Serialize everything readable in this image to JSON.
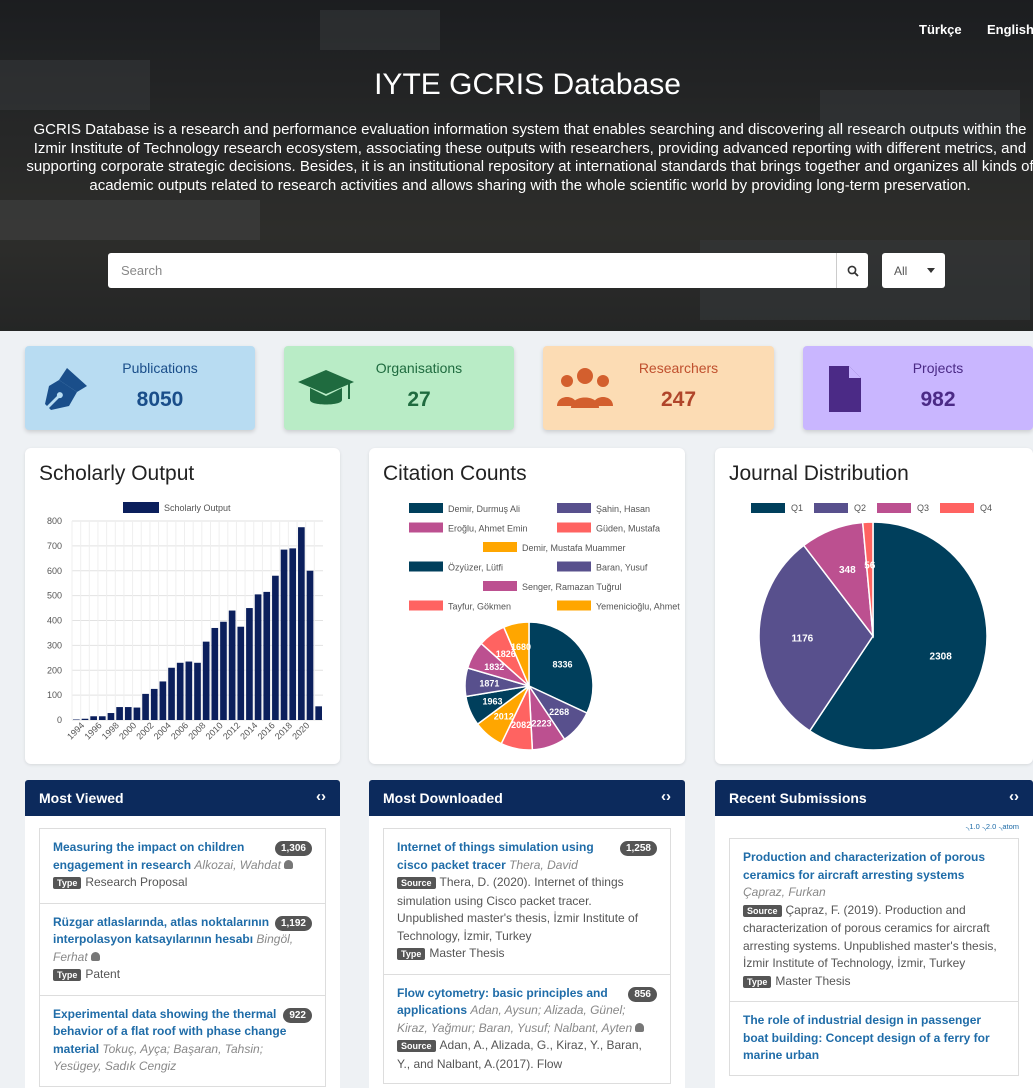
{
  "header": {
    "title": "IYTE GCRIS Database",
    "description": "GCRIS Database is a research and performance evaluation information system that enables searching and discovering all research outputs within the Izmir Institute of Technology research ecosystem, associating these outputs with researchers, providing advanced reporting with different metrics, and supporting corporate strategic decisions. Besides, it is an institutional repository at international standards that brings together and organizes all kinds of academic outputs related to research activities and allows sharing with the whole scientific world by providing long-term preservation.",
    "lang_tr": "Türkçe",
    "lang_en": "English"
  },
  "search": {
    "placeholder": "Search",
    "scope": "All"
  },
  "stats": [
    {
      "label": "Publications",
      "value": "8050",
      "icon": "pen-icon",
      "color": "#1a4e8a",
      "bg": "#b8dcf2"
    },
    {
      "label": "Organisations",
      "value": "27",
      "icon": "graduation-cap-icon",
      "color": "#1f6b3f",
      "bg": "#b9ecc6"
    },
    {
      "label": "Researchers",
      "value": "247",
      "icon": "users-icon",
      "color": "#b0452a",
      "bg": "#fcdcb4"
    },
    {
      "label": "Projects",
      "value": "982",
      "icon": "file-icon",
      "color": "#4b2a86",
      "bg": "#c9b6ff"
    }
  ],
  "charts": {
    "scholarly": "Scholarly Output",
    "citations": "Citation Counts",
    "journal": "Journal Distribution"
  },
  "chart_data": [
    {
      "type": "bar",
      "title": "Scholarly Output",
      "series": [
        {
          "name": "Scholarly Output"
        }
      ],
      "ylim": [
        0,
        800
      ],
      "yticks": [
        0,
        100,
        200,
        300,
        400,
        500,
        600,
        700,
        800
      ],
      "categories": [
        "1993",
        "1994",
        "1995",
        "1996",
        "1997",
        "1998",
        "1999",
        "2000",
        "2001",
        "2002",
        "2003",
        "2004",
        "2005",
        "2006",
        "2007",
        "2008",
        "2009",
        "2010",
        "2011",
        "2012",
        "2013",
        "2014",
        "2015",
        "2016",
        "2017",
        "2018",
        "2019",
        "2020",
        "2021"
      ],
      "xticklabels": [
        "1994",
        "1996",
        "1998",
        "2000",
        "2002",
        "2004",
        "2006",
        "2008",
        "2010",
        "2012",
        "2014",
        "2016",
        "2018",
        "2020"
      ],
      "values": [
        2,
        5,
        15,
        15,
        28,
        52,
        52,
        50,
        105,
        125,
        155,
        210,
        230,
        235,
        230,
        315,
        370,
        395,
        440,
        375,
        450,
        505,
        515,
        580,
        685,
        690,
        775,
        600,
        55
      ],
      "color": "#0b1f5c"
    },
    {
      "type": "pie",
      "title": "Citation Counts",
      "categories": [
        "Demir, Durmuş Ali",
        "Şahin, Hasan",
        "Eroğlu, Ahmet Emin",
        "Güden, Mustafa",
        "Demir, Mustafa Muammer",
        "Özyüzer, Lütfi",
        "Baran, Yusuf",
        "Senger, Ramazan Tuğrul",
        "Tayfur, Gökmen",
        "Yemenicioğlu, Ahmet"
      ],
      "values": [
        8336,
        2268,
        2223,
        2082,
        2012,
        1963,
        1871,
        1832,
        1826,
        1680
      ],
      "labels": [
        "8336",
        "2268",
        "2223",
        "2082",
        "2012",
        "1963",
        "1871",
        "1832",
        "1826",
        "1680"
      ],
      "colors": [
        "#003f5c",
        "#58508d",
        "#bc5090",
        "#ff6361",
        "#ffa600",
        "#003f5c",
        "#58508d",
        "#bc5090",
        "#ff6361",
        "#ffa600"
      ]
    },
    {
      "type": "pie",
      "title": "Journal Distribution",
      "categories": [
        "Q1",
        "Q2",
        "Q3",
        "Q4"
      ],
      "values": [
        2308,
        1176,
        348,
        56
      ],
      "labels": [
        "2308",
        "1176",
        "348",
        "56"
      ],
      "colors": [
        "#003f5c",
        "#58508d",
        "#bc5090",
        "#ff6361"
      ]
    }
  ],
  "panels": [
    {
      "title": "Most Viewed",
      "items": [
        {
          "title": "Measuring the impact on children engagement in research",
          "author": "Alkozai, Wahdat",
          "count": "1,306",
          "type": "Research Proposal"
        },
        {
          "title": "Rüzgar atlaslarında, atlas noktalarının interpolasyon katsayılarının hesabı",
          "author": "Bingöl, Ferhat",
          "count": "1,192",
          "type": "Patent"
        },
        {
          "title": "Experimental data showing the thermal behavior of a flat roof with phase change material",
          "author": "Tokuç, Ayça; Başaran, Tahsin; Yesügey, Sadık Cengiz",
          "count": "922"
        }
      ]
    },
    {
      "title": "Most Downloaded",
      "items": [
        {
          "title": "Internet of things simulation using cisco packet tracer",
          "author": "Thera, David",
          "count": "1,258",
          "source": "Thera, D. (2020). Internet of things simulation using Cisco packet tracer. Unpublished master's thesis, İzmir Institute of Technology, İzmir, Turkey",
          "type": "Master Thesis"
        },
        {
          "title": "Flow cytometry: basic principles and applications",
          "author": "Adan, Aysun; Alizada, Günel; Kiraz, Yağmur; Baran, Yusuf; Nalbant, Ayten",
          "count": "856",
          "source": "Adan, A., Alizada, G., Kiraz, Y., Baran, Y., and Nalbant, A.(2017). Flow"
        }
      ]
    },
    {
      "title": "Recent Submissions",
      "feeds": [
        "1.0",
        "2.0",
        "atom"
      ],
      "items": [
        {
          "title": "Production and characterization of porous ceramics for aircraft arresting systems",
          "author": "Çapraz, Furkan",
          "source": "Çapraz, F. (2019). Production and characterization of porous ceramics for aircraft arresting systems. Unpublished master's thesis, İzmir Institute of Technology, İzmir, Turkey",
          "type": "Master Thesis"
        },
        {
          "title": "The role of industrial design in passenger boat building: Concept design of a ferry for marine urban"
        }
      ]
    }
  ],
  "labels": {
    "type": "Type",
    "source": "Source",
    "nav_arrows": "‹›"
  }
}
